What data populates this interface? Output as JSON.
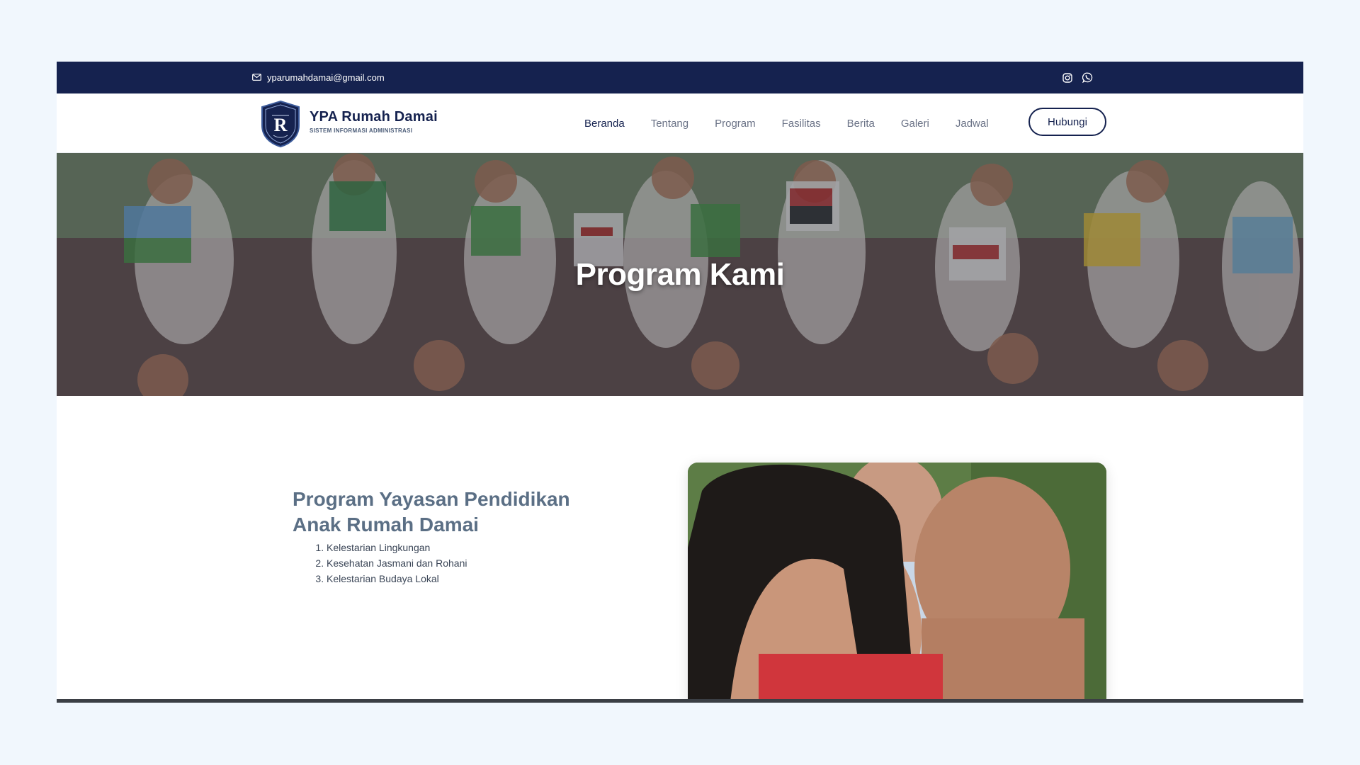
{
  "topbar": {
    "email": "yparumahdamai@gmail.com",
    "icons": [
      "mail-icon",
      "instagram-icon",
      "whatsapp-icon"
    ]
  },
  "brand": {
    "name": "YPA Rumah Damai",
    "tagline": "SISTEM INFORMASI ADMINISTRASI"
  },
  "nav": {
    "items": [
      {
        "label": "Beranda",
        "active": true
      },
      {
        "label": "Tentang"
      },
      {
        "label": "Program"
      },
      {
        "label": "Fasilitas"
      },
      {
        "label": "Berita"
      },
      {
        "label": "Galeri"
      },
      {
        "label": "Jadwal"
      }
    ],
    "contact_button": "Hubungi"
  },
  "hero": {
    "title": "Program Kami"
  },
  "section": {
    "heading": "Program Yayasan Pendidikan Anak Rumah Damai",
    "programs": [
      "Kelestarian Lingkungan",
      "Kesehatan Jasmani dan Rohani",
      "Kelestarian Budaya Lokal"
    ]
  },
  "colors": {
    "navy": "#15224f",
    "page_background": "#f1f7fd",
    "heading": "#5b6f85"
  }
}
